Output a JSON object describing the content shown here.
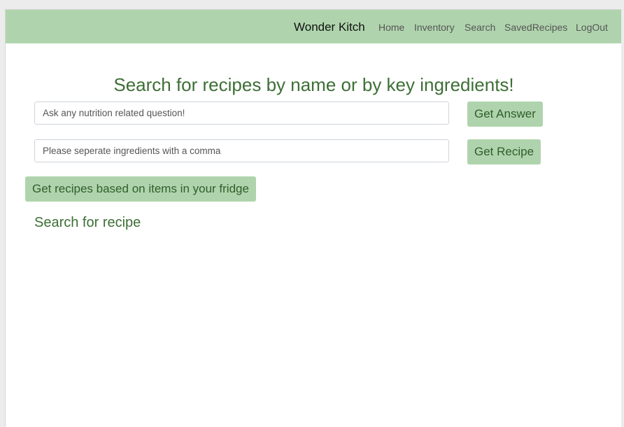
{
  "navbar": {
    "brand": "Wonder Kitch",
    "links": [
      "Home",
      "Inventory",
      "Search",
      "SavedRecipes",
      "LogOut"
    ]
  },
  "main": {
    "headline": "Search for recipes by name or by key ingredients!",
    "question_input": {
      "placeholder": "Ask any nutrition related question!",
      "value": ""
    },
    "answer_button": "Get Answer",
    "ingredients_input": {
      "placeholder": "Please seperate ingredients with a comma",
      "value": ""
    },
    "recipe_button": "Get Recipe",
    "fridge_button": "Get recipes based on items in your fridge",
    "section_title": "Search for recipe"
  },
  "colors": {
    "accent": "#afd4ad",
    "heading_text": "#3d6f36",
    "button_text": "#2f5e2a"
  }
}
